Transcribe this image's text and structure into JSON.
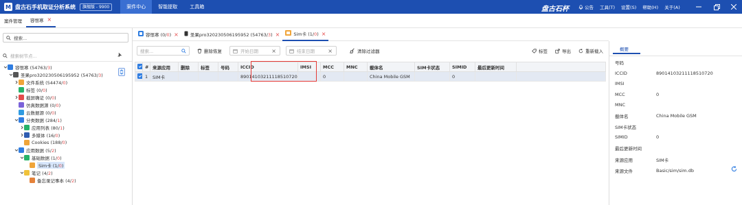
{
  "titlebar": {
    "app_title": "盘古石手机取证分析系统",
    "version": "旗舰版 - 9900",
    "menu": [
      "案件中心",
      "智能提取",
      "工具箱"
    ],
    "brand": "盘古石杯",
    "right_items": [
      "公告",
      "工具(T)",
      "设置(S)",
      "帮助(H)",
      "关于(A)"
    ]
  },
  "case_tabs": [
    {
      "label": "案件管理"
    },
    {
      "label": "容恨寒"
    }
  ],
  "left": {
    "search_placeholder": "搜索...",
    "filter_placeholder": "搜索树节点...",
    "tree": [
      {
        "indent": 0,
        "arrow": "v",
        "label": "容恨寒 (54763/",
        "red": "3",
        "tail": ")",
        "color": "#2f7de1"
      },
      {
        "indent": 1,
        "arrow": "v",
        "label": "圣果pro320230506195952 (54763/",
        "red": "3",
        "tail": ")",
        "color": "#555"
      },
      {
        "indent": 2,
        "arrow": ">",
        "label": "文件系统 (54474/",
        "red": "0",
        "tail": ")",
        "color": "#f0a53a"
      },
      {
        "indent": 2,
        "arrow": "",
        "label": "标签 (0/",
        "red": "0",
        "tail": ")",
        "color": "#27b36a"
      },
      {
        "indent": 2,
        "arrow": ">",
        "label": "截屏确证 (0/",
        "red": "0",
        "tail": ")",
        "color": "#e54b4b"
      },
      {
        "indent": 2,
        "arrow": "",
        "label": "仿真数据源 (0/",
        "red": "0",
        "tail": ")",
        "color": "#7a62d9"
      },
      {
        "indent": 2,
        "arrow": "",
        "label": "云数据源 (0/",
        "red": "0",
        "tail": ")",
        "color": "#2f9be1"
      },
      {
        "indent": 2,
        "arrow": "v",
        "label": "分类数据 (284/",
        "red": "1",
        "tail": ")",
        "color": "#2f7de1"
      },
      {
        "indent": 3,
        "arrow": ">",
        "label": "应用列表 (80/",
        "red": "1",
        "tail": ")",
        "color": "#27b36a"
      },
      {
        "indent": 3,
        "arrow": ">",
        "label": "多媒体 (16/",
        "red": "0",
        "tail": ")",
        "color": "#2f5db1"
      },
      {
        "indent": 3,
        "arrow": "",
        "label": "Cookies (188/",
        "red": "0",
        "tail": ")",
        "color": "#f0a53a"
      },
      {
        "indent": 2,
        "arrow": "v",
        "label": "应用数据 (5/",
        "red": "2",
        "tail": ")",
        "color": "#2f7de1"
      },
      {
        "indent": 3,
        "arrow": "v",
        "label": "基础数据 (1/",
        "red": "0",
        "tail": ")",
        "color": "#27b36a"
      },
      {
        "indent": 4,
        "arrow": "",
        "label": "Sim卡 (1/",
        "red": "0",
        "tail": ")",
        "color": "#f0a53a",
        "selected": true
      },
      {
        "indent": 3,
        "arrow": "v",
        "label": "笔记 (4/",
        "red": "2",
        "tail": ")",
        "color": "#f0c23a"
      },
      {
        "indent": 4,
        "arrow": "",
        "label": "备忘录记事本 (4/",
        "red": "2",
        "tail": ")",
        "color": "#e5823a"
      }
    ]
  },
  "main": {
    "tabs": [
      {
        "label": "容恨寒 (0/",
        "red": "0",
        "tail": ")"
      },
      {
        "label": "圣果pro320230506195952 (54763/",
        "red": "3",
        "tail": ")"
      },
      {
        "label": "Sim卡 (1/",
        "red": "0",
        "tail": ")"
      }
    ],
    "toolbar": {
      "search_placeholder": "搜索...",
      "restore_label": "删除恢复",
      "start_date_placeholder": "开始日期",
      "end_date_placeholder": "结束日期",
      "clear_filter_label": "清除过滤器",
      "tag_label": "标签",
      "export_label": "导出",
      "reload_label": "重新载入"
    },
    "columns": [
      "#",
      "来源应用",
      "删除",
      "标签",
      "号码",
      "ICCID",
      "IMSI",
      "MCC",
      "MNC",
      "載体名",
      "SIM卡状态",
      "SIMID",
      "最后更新时间"
    ],
    "rows": [
      [
        "1",
        "SIM卡",
        "",
        "",
        "",
        "89014103211118510720",
        "",
        "0",
        "",
        "China Mobile GSM",
        "",
        "0",
        ""
      ]
    ]
  },
  "right": {
    "tab": "概要",
    "props": [
      {
        "k": "号码",
        "v": ""
      },
      {
        "k": "ICCID",
        "v": "89014103211118510720"
      },
      {
        "k": "IMSI",
        "v": ""
      },
      {
        "k": "MCC",
        "v": "0"
      },
      {
        "k": "MNC",
        "v": ""
      },
      {
        "k": "載体名",
        "v": "China Mobile GSM"
      },
      {
        "k": "SIM卡状态",
        "v": ""
      },
      {
        "k": "SIMID",
        "v": "0"
      },
      {
        "k": "最后更新时间",
        "v": ""
      },
      {
        "k": "来源应用",
        "v": "SIM卡"
      },
      {
        "k": "来源文件",
        "v": "Basic/sim/sim.db"
      }
    ]
  },
  "colors": {
    "accent": "#1d4fb1",
    "deleted_red": "#e54b4b",
    "highlight": "#e53935"
  }
}
